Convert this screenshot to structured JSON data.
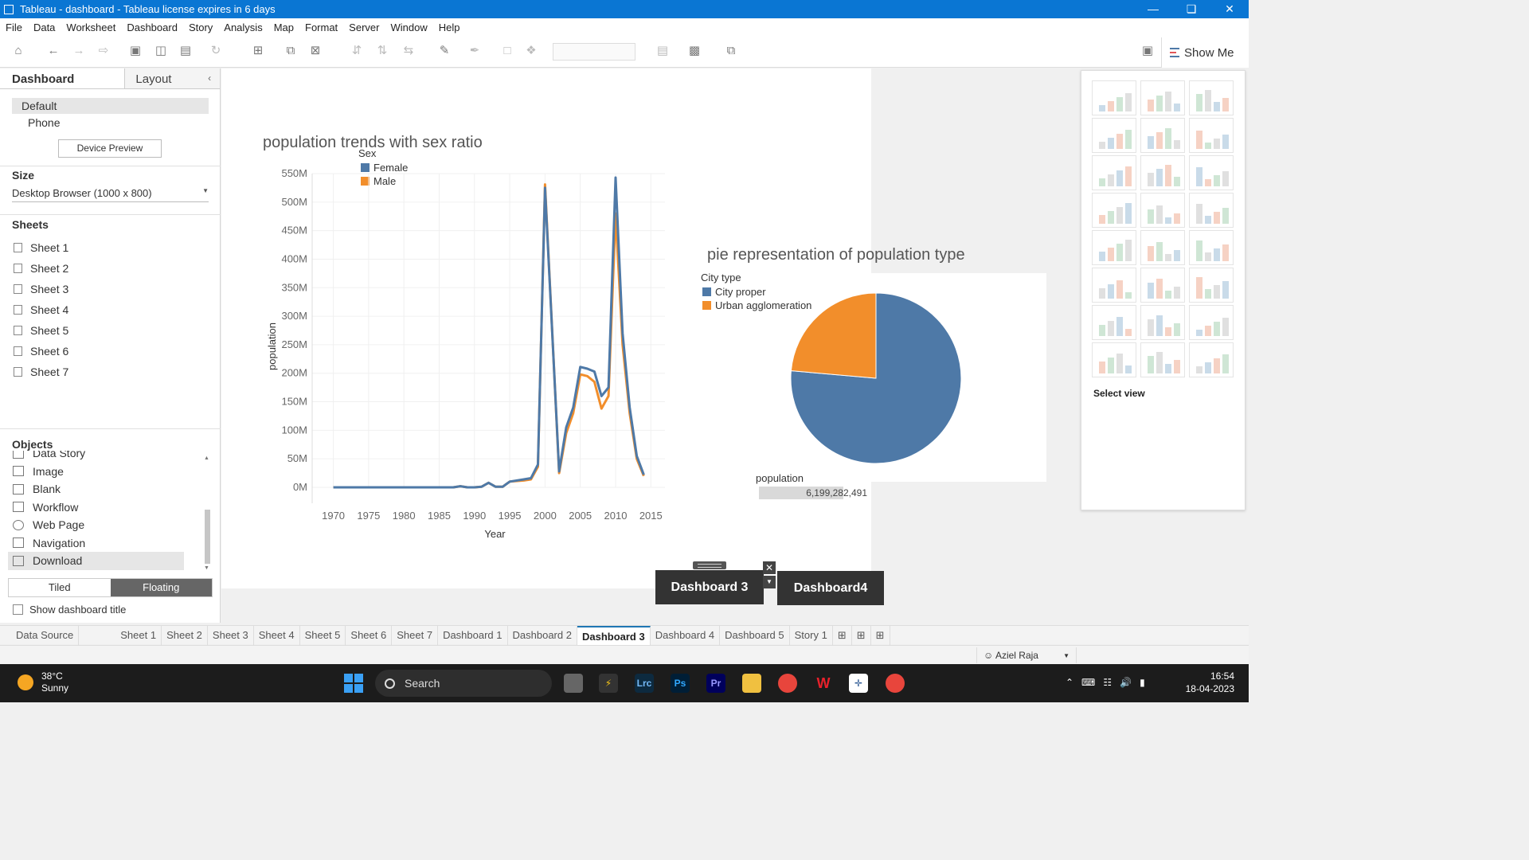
{
  "window": {
    "title": "Tableau - dashboard - Tableau license expires in 6 days"
  },
  "menu": [
    "File",
    "Data",
    "Worksheet",
    "Dashboard",
    "Story",
    "Analysis",
    "Map",
    "Format",
    "Server",
    "Window",
    "Help"
  ],
  "toolbar": {
    "show_me_label": "Show Me"
  },
  "left_pane": {
    "tab_dashboard": "Dashboard",
    "tab_layout": "Layout",
    "device_default": "Default",
    "device_phone": "Phone",
    "device_preview_button": "Device Preview",
    "size_heading": "Size",
    "size_value": "Desktop Browser (1000 x 800)",
    "sheets_heading": "Sheets",
    "sheets": [
      "Sheet 1",
      "Sheet 2",
      "Sheet 3",
      "Sheet 4",
      "Sheet 5",
      "Sheet 6",
      "Sheet 7"
    ],
    "objects_heading": "Objects",
    "objects": [
      "Data Story",
      "Image",
      "Blank",
      "Workflow",
      "Web Page",
      "Navigation",
      "Download"
    ],
    "selected_object": "Download",
    "tiled_label": "Tiled",
    "floating_label": "Floating",
    "show_title_label": "Show dashboard title"
  },
  "dashboard": {
    "nav_buttons": [
      "Dashboard 3",
      "Dashboard4"
    ],
    "total_label": "population",
    "total_value": "6,199,282,491",
    "total_fill": 0.77
  },
  "show_me": {
    "select_view_label": "Select view"
  },
  "chart_data": [
    {
      "type": "line",
      "title": "population trends with sex ratio",
      "xlabel": "Year",
      "ylabel": "population",
      "legend_title": "Sex",
      "xlim": [
        1967,
        2017
      ],
      "ylim": [
        0,
        550000000
      ],
      "xticks": [
        1970,
        1975,
        1980,
        1985,
        1990,
        1995,
        2000,
        2005,
        2010,
        2015
      ],
      "yticks": [
        "0M",
        "50M",
        "100M",
        "150M",
        "200M",
        "250M",
        "300M",
        "350M",
        "400M",
        "450M",
        "500M",
        "550M"
      ],
      "grid": true,
      "legend_position": "top-left",
      "series": [
        {
          "name": "Female",
          "color": "#4e79a7",
          "points": [
            [
              1970,
              0
            ],
            [
              1975,
              0
            ],
            [
              1980,
              0
            ],
            [
              1985,
              0
            ],
            [
              1987,
              0
            ],
            [
              1988,
              2000000
            ],
            [
              1989,
              0
            ],
            [
              1990,
              0
            ],
            [
              1991,
              1000000
            ],
            [
              1992,
              8000000
            ],
            [
              1993,
              1000000
            ],
            [
              1994,
              1000000
            ],
            [
              1995,
              10000000
            ],
            [
              1997,
              14000000
            ],
            [
              1998,
              16000000
            ],
            [
              1999,
              40000000
            ],
            [
              2000,
              525000000
            ],
            [
              2002,
              28000000
            ],
            [
              2003,
              105000000
            ],
            [
              2004,
              140000000
            ],
            [
              2005,
              211000000
            ],
            [
              2006,
              208000000
            ],
            [
              2007,
              203000000
            ],
            [
              2008,
              160000000
            ],
            [
              2009,
              175000000
            ],
            [
              2010,
              543000000
            ],
            [
              2011,
              270000000
            ],
            [
              2012,
              140000000
            ],
            [
              2013,
              55000000
            ],
            [
              2014,
              22000000
            ]
          ]
        },
        {
          "name": "Male",
          "color": "#f28e2b",
          "points": [
            [
              1970,
              0
            ],
            [
              1975,
              0
            ],
            [
              1980,
              0
            ],
            [
              1985,
              0
            ],
            [
              1987,
              0
            ],
            [
              1988,
              2000000
            ],
            [
              1989,
              0
            ],
            [
              1990,
              0
            ],
            [
              1991,
              1000000
            ],
            [
              1992,
              8000000
            ],
            [
              1993,
              1000000
            ],
            [
              1994,
              1000000
            ],
            [
              1995,
              10000000
            ],
            [
              1997,
              12000000
            ],
            [
              1998,
              14000000
            ],
            [
              1999,
              36000000
            ],
            [
              2000,
              531000000
            ],
            [
              2002,
              25000000
            ],
            [
              2003,
              95000000
            ],
            [
              2004,
              130000000
            ],
            [
              2005,
              198000000
            ],
            [
              2006,
              195000000
            ],
            [
              2007,
              185000000
            ],
            [
              2008,
              138000000
            ],
            [
              2009,
              160000000
            ],
            [
              2010,
              480000000
            ],
            [
              2011,
              250000000
            ],
            [
              2012,
              130000000
            ],
            [
              2013,
              50000000
            ],
            [
              2014,
              20000000
            ]
          ]
        }
      ]
    },
    {
      "type": "pie",
      "title": "pie representation of population type",
      "legend_title": "City type",
      "legend_position": "top-left",
      "slices": [
        {
          "name": "City proper",
          "value": 0.764,
          "color": "#4e79a7"
        },
        {
          "name": "Urban agglomeration",
          "value": 0.236,
          "color": "#f28e2b"
        }
      ]
    }
  ],
  "sheet_tabs": [
    "Data Source",
    "Sheet 1",
    "Sheet 2",
    "Sheet 3",
    "Sheet 4",
    "Sheet 5",
    "Sheet 6",
    "Sheet 7",
    "Dashboard 1",
    "Dashboard 2",
    "Dashboard 3",
    "Dashboard 4",
    "Dashboard 5",
    "Story 1"
  ],
  "active_tab": "Dashboard 3",
  "status": {
    "user": "Aziel Raja"
  },
  "taskbar": {
    "temperature": "38°C",
    "weather": "Sunny",
    "search_label": "Search",
    "time": "16:54",
    "date": "18-04-2023"
  }
}
